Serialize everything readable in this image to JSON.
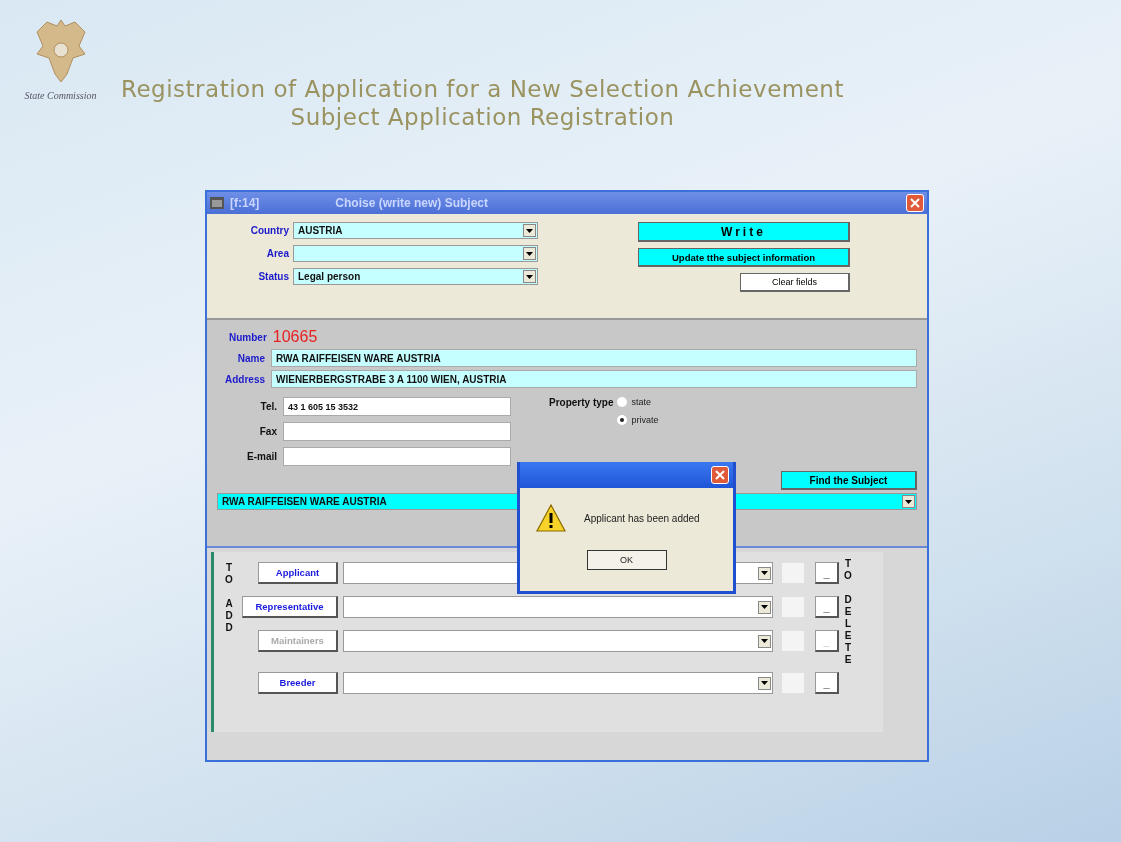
{
  "slide": {
    "title": "Registration of Application for a New Selection Achievement",
    "subtitle": "Subject Application Registration",
    "logo_caption": "State Commission"
  },
  "window": {
    "id_label": "[f:14]",
    "title": "Choise  (write new)  Subject"
  },
  "top_form": {
    "fields": [
      {
        "label": "Country",
        "value": "AUSTRIA"
      },
      {
        "label": "Area"
      },
      {
        "label": "Status",
        "value": "Legal person"
      }
    ],
    "buttons": [
      {
        "label": "Write",
        "kind": "primary"
      },
      {
        "label": "Update tthe subject information",
        "kind": "primary"
      },
      {
        "label": "Clear fields",
        "kind": "plain"
      }
    ]
  },
  "subject": {
    "number_label": "Number",
    "number": "10665",
    "name_label": "Name",
    "name": "RWA RAIFFEISEN WARE AUSTRIA",
    "address_label": "Address",
    "address": "WIENERBERGSTRABE 3 A 1100 WIEN, AUSTRIA",
    "contacts": [
      {
        "label": "Tel.",
        "value": "43 1 605 15 3532"
      },
      {
        "label": "Fax"
      },
      {
        "label": "E-mail"
      }
    ],
    "property_type": {
      "label": "Property type",
      "options": [
        {
          "label": "state",
          "selected": false
        },
        {
          "label": "private",
          "selected": true
        }
      ]
    },
    "find_button": "Find the Subject",
    "found": "RWA RAIFFEISEN WARE AUSTRIA"
  },
  "roles": {
    "left_label": [
      "TO",
      "ADD"
    ],
    "right_label": [
      "TO",
      "DELETE"
    ],
    "rows": [
      {
        "label": "Applicant",
        "disabled": false,
        "delete_label": "_"
      },
      {
        "label": "Representative",
        "disabled": false,
        "delete_label": "_"
      },
      {
        "label": "Maintainers",
        "disabled": true,
        "delete_label": "_"
      },
      {
        "label": "Breeder",
        "disabled": false,
        "delete_label": "_"
      }
    ]
  },
  "dialog": {
    "message": "Applicant has been added",
    "button": "OK"
  }
}
